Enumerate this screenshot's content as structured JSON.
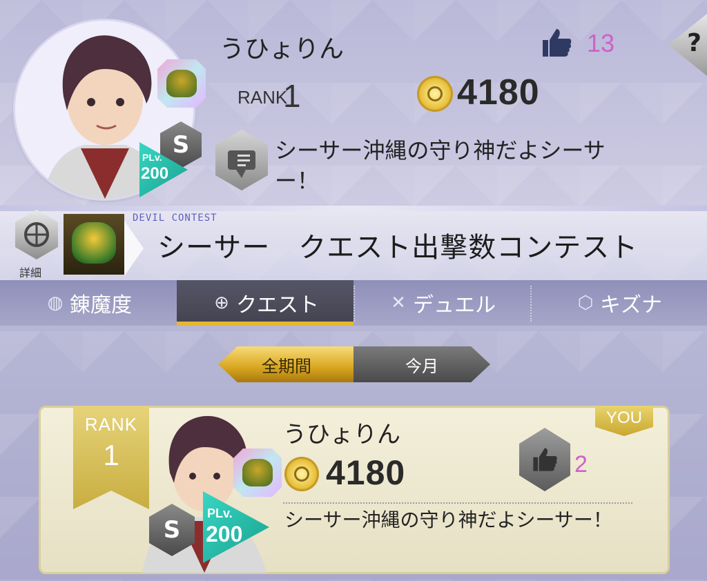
{
  "profile": {
    "name": "うひょりん",
    "rank_label": "RANK",
    "rank_value": "1",
    "points": "4180",
    "likes": "13",
    "help": "?",
    "comment": "シーサー沖縄の守り神だよシーサー！",
    "title_rank": "S",
    "plv_label": "PLv.",
    "plv_value": "200"
  },
  "contest": {
    "detail_label": "詳細",
    "subtitle": "DEVIL CONTEST",
    "title": "シーサー　クエスト出撃数コンテスト"
  },
  "tabs": [
    {
      "label": "錬魔度",
      "icon": "sprite-icon"
    },
    {
      "label": "クエスト",
      "icon": "quest-icon"
    },
    {
      "label": "デュエル",
      "icon": "swords-icon"
    },
    {
      "label": "キズナ",
      "icon": "bond-icon"
    }
  ],
  "period": {
    "all": "全期間",
    "month": "今月"
  },
  "entry": {
    "rank_label": "RANK",
    "rank_value": "1",
    "you": "YOU",
    "name": "うひょりん",
    "points": "4180",
    "likes": "2",
    "comment": "シーサー沖縄の守り神だよシーサー！",
    "title_rank": "S",
    "plv_label": "PLv.",
    "plv_value": "200"
  },
  "colors": {
    "accent_gold": "#e7b62e",
    "like_pink": "#d060c8",
    "contest_blue": "#5e5ec0"
  }
}
